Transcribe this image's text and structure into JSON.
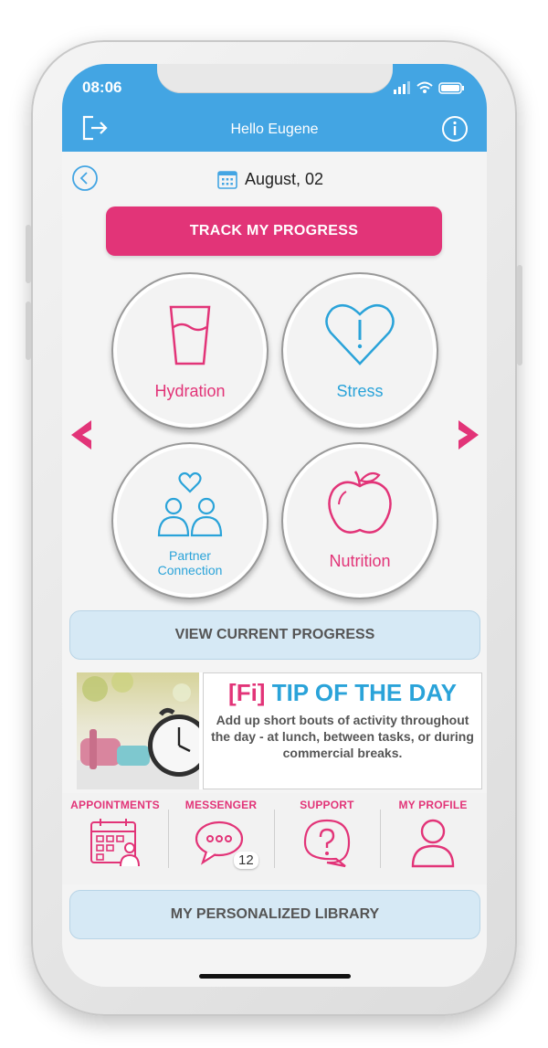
{
  "status": {
    "time": "08:06"
  },
  "header": {
    "title": "Hello Eugene"
  },
  "date": {
    "label": "August, 02"
  },
  "track_button": {
    "label": "TRACK MY PROGRESS"
  },
  "categories": [
    {
      "label": "Hydration",
      "icon": "glass-icon",
      "color": "#e23478"
    },
    {
      "label": "Stress",
      "icon": "heart-exclamation-icon",
      "color": "#2aa3d9"
    },
    {
      "label": "Partner Connection",
      "icon": "partner-icon",
      "color": "#2aa3d9"
    },
    {
      "label": "Nutrition",
      "icon": "apple-icon",
      "color": "#e23478"
    }
  ],
  "view_progress": {
    "label": "VIEW CURRENT PROGRESS"
  },
  "tip": {
    "brand": "[Fi]",
    "title": "TIP OF THE DAY",
    "text": "Add up short bouts of activity throughout the day - at lunch, between tasks, or during commercial breaks."
  },
  "nav": [
    {
      "label": "APPOINTMENTS",
      "icon": "calendar-icon"
    },
    {
      "label": "MESSENGER",
      "icon": "chat-icon",
      "badge": "12"
    },
    {
      "label": "SUPPORT",
      "icon": "question-icon"
    },
    {
      "label": "MY PROFILE",
      "icon": "profile-icon"
    }
  ],
  "library": {
    "label": "MY PERSONALIZED LIBRARY"
  },
  "colors": {
    "accent": "#e23478",
    "header": "#43a5e3",
    "blue_icon": "#2aa3d9"
  }
}
